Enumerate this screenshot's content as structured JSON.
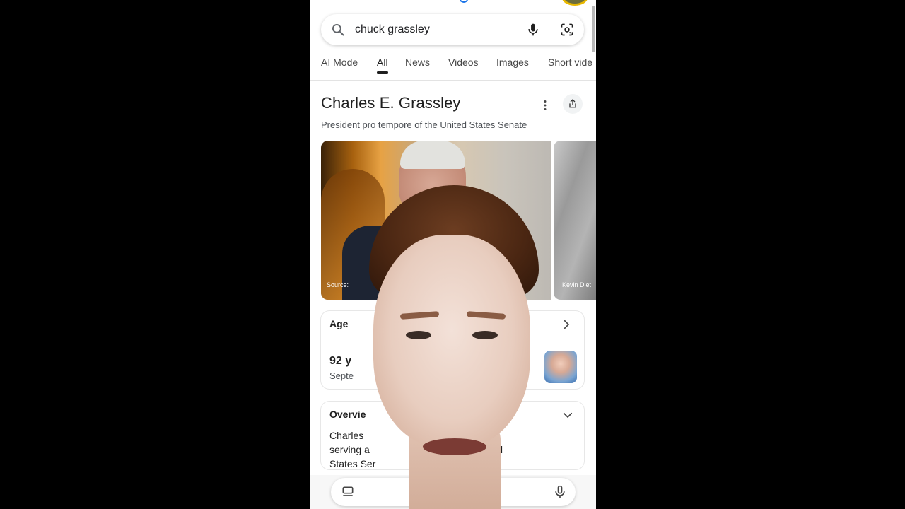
{
  "search": {
    "query": "chuck grassley"
  },
  "tabs": [
    {
      "label": "AI Mode"
    },
    {
      "label": "All"
    },
    {
      "label": "News"
    },
    {
      "label": "Videos"
    },
    {
      "label": "Images"
    },
    {
      "label": "Short vide"
    }
  ],
  "active_tab": "All",
  "knowledge_panel": {
    "title": "Charles E. Grassley",
    "subtitle": "President pro tempore of the United States Senate",
    "images": [
      {
        "caption": "Source:"
      },
      {
        "caption": "Kevin Diet"
      }
    ],
    "age_card": {
      "title": "Age",
      "value": "92 y",
      "sub": "Septe"
    },
    "overview_card": {
      "title": "Overvie",
      "lines": [
        "Charles                                    olitician",
        "serving a                                the United",
        "States Ser                              held from"
      ]
    }
  },
  "icons": {
    "search": "search-icon",
    "mic": "mic-icon",
    "lens": "lens-icon",
    "more": "more-vert-icon",
    "share": "share-icon",
    "chevron_right": "chevron-right-icon",
    "chevron_down": "chevron-down-icon"
  },
  "colors": {
    "accent": "#1a73e8",
    "text_primary": "#1f1f1f",
    "text_secondary": "#4d5156"
  }
}
